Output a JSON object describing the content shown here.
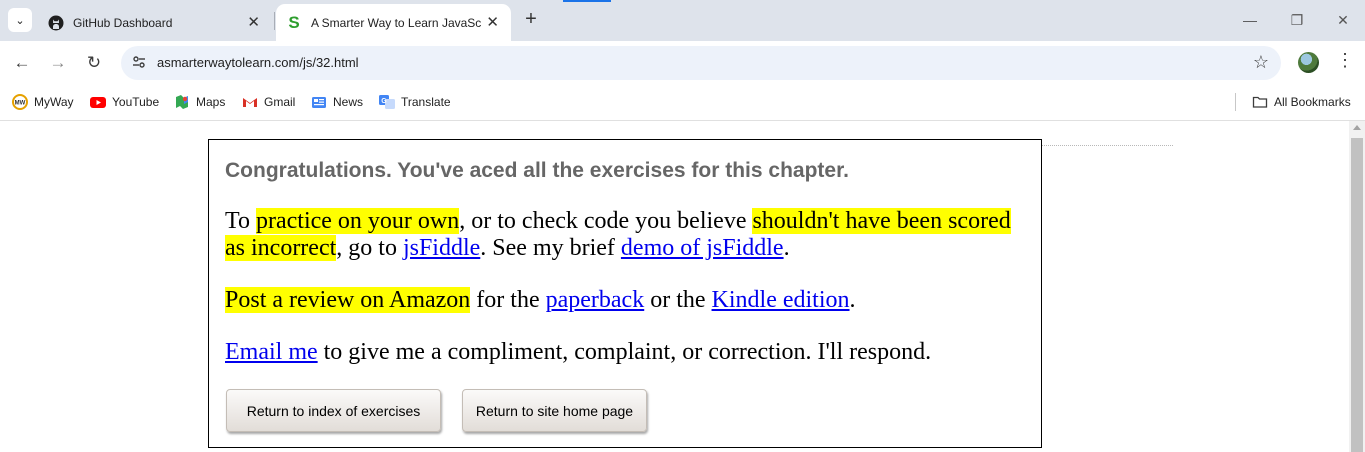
{
  "browser": {
    "tabs": [
      {
        "title": "GitHub Dashboard",
        "icon": "github-icon",
        "active": false
      },
      {
        "title": "A Smarter Way to Learn JavaScript",
        "icon": "smarter-way-favicon",
        "active": true
      }
    ],
    "new_tab": "+",
    "window_controls": {
      "minimize": "—",
      "restore": "❐",
      "close": "✕"
    },
    "address_bar": {
      "url": "asmarterwaytolearn.com/js/32.html"
    },
    "bookmarks": [
      {
        "label": "MyWay",
        "icon": "myway-icon"
      },
      {
        "label": "YouTube",
        "icon": "youtube-icon"
      },
      {
        "label": "Maps",
        "icon": "maps-icon"
      },
      {
        "label": "Gmail",
        "icon": "gmail-icon"
      },
      {
        "label": "News",
        "icon": "news-icon"
      },
      {
        "label": "Translate",
        "icon": "translate-icon"
      }
    ],
    "all_bookmarks": "All Bookmarks",
    "accent_color": "#1a73e8"
  },
  "page": {
    "heading": "Congratulations. You've aced all the exercises for this chapter.",
    "p1": {
      "t1": "To ",
      "h1": "practice on your own",
      "t2": ", or to check code you believe ",
      "h2": "shouldn't have been scored as incorrect",
      "t3": ", go to ",
      "link1": "jsFiddle",
      "t4": ". See my brief ",
      "link2": "demo of jsFiddle",
      "t5": "."
    },
    "p2": {
      "h1": "Post a review on Amazon",
      "t1": " for the ",
      "link1": "paperback",
      "t2": " or the ",
      "link2": "Kindle edition",
      "t3": "."
    },
    "p3": {
      "link1": "Email me",
      "t1": " to give me a compliment, complaint, or correction. I'll respond."
    },
    "buttons": {
      "index": "Return to index of exercises",
      "home": "Return to site home page"
    },
    "colors": {
      "highlight": "#ffff00",
      "link": "#0000ee",
      "heading": "#666666"
    }
  }
}
